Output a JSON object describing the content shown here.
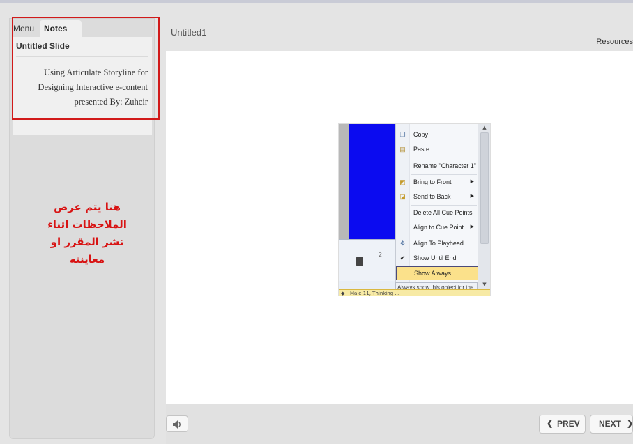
{
  "sidebar": {
    "tabs": [
      {
        "label": "Menu",
        "active": false
      },
      {
        "label": "Notes",
        "active": true
      }
    ],
    "slide_title": "Untitled Slide",
    "notes_lines": [
      "Using Articulate Storyline for",
      "Designing Interactive e-content",
      "presented By: Zuheir"
    ],
    "annotation_lines": [
      "هنا يتم عرض",
      "الملاحظات اثناء",
      "نشر المقرر او",
      "معاينته"
    ],
    "annotation_color": "#d81313"
  },
  "header": {
    "title": "Untitled1",
    "resources_label": "Resources"
  },
  "slide_image": {
    "context_menu": {
      "items": [
        {
          "label": "Copy",
          "icon": "copy-icon"
        },
        {
          "label": "Paste",
          "icon": "paste-icon"
        },
        {
          "label": "Rename \"Character 1\"",
          "icon": ""
        },
        {
          "label": "Bring to Front",
          "icon": "bring-front-icon"
        },
        {
          "label": "Send to Back",
          "icon": "send-back-icon"
        },
        {
          "label": "Delete All Cue Points",
          "icon": ""
        },
        {
          "label": "Align to Cue Point",
          "icon": ""
        },
        {
          "label": "Align To Playhead",
          "icon": "playhead-icon"
        },
        {
          "label": "Show Until End",
          "icon": "check-icon"
        },
        {
          "label": "Show Always",
          "icon": ""
        }
      ],
      "tooltip": "Always show this object for the",
      "timeline_text": "Male 11, Thinking ..."
    }
  },
  "footer": {
    "prev_label": "PREV",
    "next_label": "NEXT"
  }
}
